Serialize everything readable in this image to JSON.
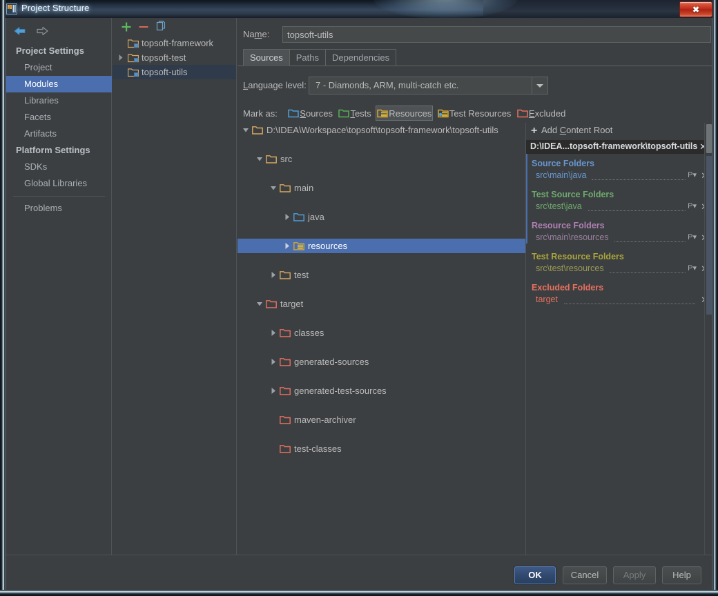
{
  "window": {
    "title": "Project Structure",
    "app_icon": "intellij-idea-logo-icon",
    "close_label": "✖"
  },
  "sidebar": {
    "back_icon": "arrow-left-icon",
    "forward_icon": "arrow-right-icon",
    "items": [
      {
        "label": "Project Settings",
        "type": "group",
        "selected": false
      },
      {
        "label": "Project",
        "type": "child",
        "selected": false
      },
      {
        "label": "Modules",
        "type": "child",
        "selected": true
      },
      {
        "label": "Libraries",
        "type": "child",
        "selected": false
      },
      {
        "label": "Facets",
        "type": "child",
        "selected": false
      },
      {
        "label": "Artifacts",
        "type": "child",
        "selected": false
      },
      {
        "label": "Platform Settings",
        "type": "group",
        "selected": false
      },
      {
        "label": "SDKs",
        "type": "child",
        "selected": false
      },
      {
        "label": "Global Libraries",
        "type": "child",
        "selected": false
      },
      {
        "label": "Problems",
        "type": "child",
        "selected": false
      }
    ]
  },
  "modules_panel": {
    "toolbar": {
      "add_icon": "plus-icon",
      "remove_icon": "minus-icon",
      "copy_icon": "copy-icon"
    },
    "items": [
      {
        "label": "topsoft-framework",
        "expandable": false,
        "selected": false
      },
      {
        "label": "topsoft-test",
        "expandable": true,
        "selected": false
      },
      {
        "label": "topsoft-utils",
        "expandable": false,
        "selected": true
      }
    ]
  },
  "detail": {
    "name_label": "Name:",
    "name_value": "topsoft-utils",
    "name_placeholder": "",
    "tabs": [
      {
        "label": "Sources",
        "active": true
      },
      {
        "label": "Paths",
        "active": false
      },
      {
        "label": "Dependencies",
        "active": false
      }
    ],
    "language_level_label": "Language level:",
    "language_level_value": "7 - Diamonds, ARM, multi-catch etc.",
    "language_level_arrow": "chevron-down-icon",
    "mark_as_label": "Mark as:",
    "mark_as_buttons": [
      {
        "label": "Sources",
        "color": "#4f9fd8",
        "pressed": false,
        "icon": "folder-sources-icon"
      },
      {
        "label": "Tests",
        "color": "#54b254",
        "pressed": false,
        "icon": "folder-tests-icon"
      },
      {
        "label": "Resources",
        "color": "#d9a62e",
        "pressed": true,
        "icon": "folder-resources-icon"
      },
      {
        "label": "Test Resources",
        "color": "#d9a62e",
        "pressed": false,
        "icon": "folder-test-resources-icon"
      },
      {
        "label": "Excluded",
        "color": "#e8705f",
        "pressed": false,
        "icon": "folder-excluded-icon"
      }
    ]
  },
  "tree": [
    {
      "label": "D:\\IDEA\\Workspace\\topsoft\\topsoft-framework\\topsoft-utils",
      "depth": 0,
      "state": "expanded",
      "icon": "folder-plain-icon",
      "color": "#d7a860",
      "selected": false
    },
    {
      "label": "src",
      "depth": 1,
      "state": "expanded",
      "icon": "folder-plain-icon",
      "color": "#d7a860",
      "selected": false
    },
    {
      "label": "main",
      "depth": 2,
      "state": "expanded",
      "icon": "folder-plain-icon",
      "color": "#d7a860",
      "selected": false
    },
    {
      "label": "java",
      "depth": 3,
      "state": "collapsed",
      "icon": "folder-sources-icon",
      "color": "#4f9fd8",
      "selected": false
    },
    {
      "label": "resources",
      "depth": 3,
      "state": "collapsed",
      "icon": "folder-resources-icon",
      "color": "#d9a62e",
      "selected": true
    },
    {
      "label": "test",
      "depth": 2,
      "state": "collapsed",
      "icon": "folder-plain-icon",
      "color": "#d7a860",
      "selected": false
    },
    {
      "label": "target",
      "depth": 1,
      "state": "expanded",
      "icon": "folder-excluded-icon",
      "color": "#e8705f",
      "selected": false
    },
    {
      "label": "classes",
      "depth": 2,
      "state": "collapsed",
      "icon": "folder-excluded-icon",
      "color": "#e8705f",
      "selected": false
    },
    {
      "label": "generated-sources",
      "depth": 2,
      "state": "collapsed",
      "icon": "folder-excluded-icon",
      "color": "#e8705f",
      "selected": false
    },
    {
      "label": "generated-test-sources",
      "depth": 2,
      "state": "collapsed",
      "icon": "folder-excluded-icon",
      "color": "#e8705f",
      "selected": false
    },
    {
      "label": "maven-archiver",
      "depth": 2,
      "state": "leaf",
      "icon": "folder-excluded-icon",
      "color": "#e8705f",
      "selected": false
    },
    {
      "label": "test-classes",
      "depth": 2,
      "state": "leaf",
      "icon": "folder-excluded-icon",
      "color": "#e8705f",
      "selected": false
    }
  ],
  "roots_panel": {
    "add_content_root_label": "Add Content Root",
    "add_content_root_mnemonic": "C",
    "add_icon": "plus-icon",
    "content_root_path": "D:\\IDEA...topsoft-framework\\topsoft-utils",
    "content_root_close_icon": "close-icon",
    "sections": [
      {
        "title": "Source Folders",
        "color": "#6897d0",
        "entries": [
          {
            "path": "src\\main\\java",
            "has_package_prefix": true,
            "package_prefix_icon": "package-prefix-icon",
            "remove_icon": "close-icon"
          }
        ]
      },
      {
        "title": "Test Source Folders",
        "color": "#6fa96f",
        "entries": [
          {
            "path": "src\\test\\java",
            "has_package_prefix": true,
            "package_prefix_icon": "package-prefix-icon",
            "remove_icon": "close-icon"
          }
        ]
      },
      {
        "title": "Resource Folders",
        "color": "#b07fb5",
        "entries": [
          {
            "path": "src\\main\\resources",
            "has_package_prefix": true,
            "package_prefix_icon": "package-prefix-icon",
            "remove_icon": "close-icon"
          }
        ]
      },
      {
        "title": "Test Resource Folders",
        "color": "#aaa43a",
        "entries": [
          {
            "path": "src\\test\\resources",
            "has_package_prefix": true,
            "package_prefix_icon": "package-prefix-icon",
            "remove_icon": "close-icon"
          }
        ]
      },
      {
        "title": "Excluded Folders",
        "color": "#e8705f",
        "entries": [
          {
            "path": "target",
            "has_package_prefix": false,
            "remove_icon": "close-icon"
          }
        ]
      }
    ]
  },
  "buttons": {
    "ok": "OK",
    "cancel": "Cancel",
    "apply": "Apply",
    "help": "Help"
  },
  "colors": {
    "window_bg": "#3c3f41",
    "selection_blue": "#4b6eaf",
    "module_selection": "#2f3b4b",
    "text": "#bbbbbb",
    "border": "#5e6364"
  }
}
